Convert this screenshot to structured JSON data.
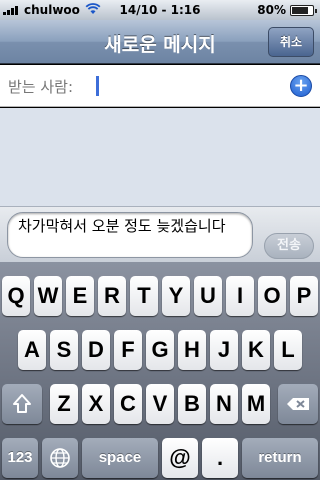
{
  "status_bar": {
    "carrier": "chulwoo",
    "time": "14/10 - 1:16",
    "battery_percent": "80%",
    "battery_level": 0.8
  },
  "nav_bar": {
    "title": "새로운 메시지",
    "cancel_label": "취소"
  },
  "to_field": {
    "label": "받는 사람:",
    "add_icon": "plus-circle-icon"
  },
  "compose": {
    "message_text": "차가막혀서 오분 정도 늦겠습니다",
    "send_label": "전송"
  },
  "keyboard": {
    "row1": [
      "Q",
      "W",
      "E",
      "R",
      "T",
      "Y",
      "U",
      "I",
      "O",
      "P"
    ],
    "row2": [
      "A",
      "S",
      "D",
      "F",
      "G",
      "H",
      "J",
      "K",
      "L"
    ],
    "row3": [
      "Z",
      "X",
      "C",
      "V",
      "B",
      "N",
      "M"
    ],
    "shift_icon": "shift-arrow-icon",
    "delete_icon": "backspace-icon",
    "numbers_label": "123",
    "globe_icon": "globe-icon",
    "space_label": "space",
    "at_label": "@",
    "period_label": ".",
    "return_label": "return"
  }
}
